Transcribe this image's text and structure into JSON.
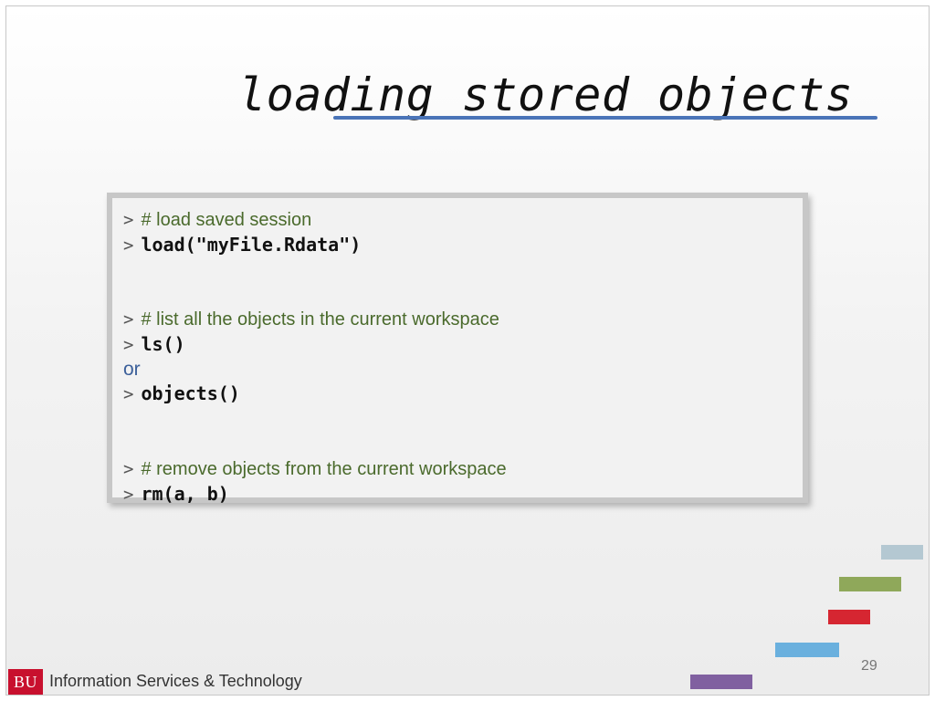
{
  "slide": {
    "title": "loading stored objects",
    "page_number": "29"
  },
  "code_box": {
    "lines": [
      {
        "prompt": ">",
        "comment": "# load saved session"
      },
      {
        "prompt": ">",
        "code": "load(\"myFile.Rdata\")"
      },
      {
        "prompt": ">",
        "comment": "# list all the objects in the current workspace"
      },
      {
        "prompt": ">",
        "code": "ls()"
      },
      {
        "text": "or"
      },
      {
        "prompt": ">",
        "code": "objects()"
      },
      {
        "prompt": ">",
        "comment": "# remove objects from the current workspace"
      },
      {
        "prompt": ">",
        "code": "rm(a, b)"
      }
    ]
  },
  "footer": {
    "logo_text": "BU",
    "org_name": "Information Services & Technology"
  },
  "colors": {
    "title_underline": "#4a74b8",
    "bar_1": "#b4c8d2",
    "bar_2": "#8fa85a",
    "bar_3": "#d62631",
    "bar_4": "#6ab0de",
    "bar_5": "#8060a0",
    "bu_red": "#c8102e"
  }
}
